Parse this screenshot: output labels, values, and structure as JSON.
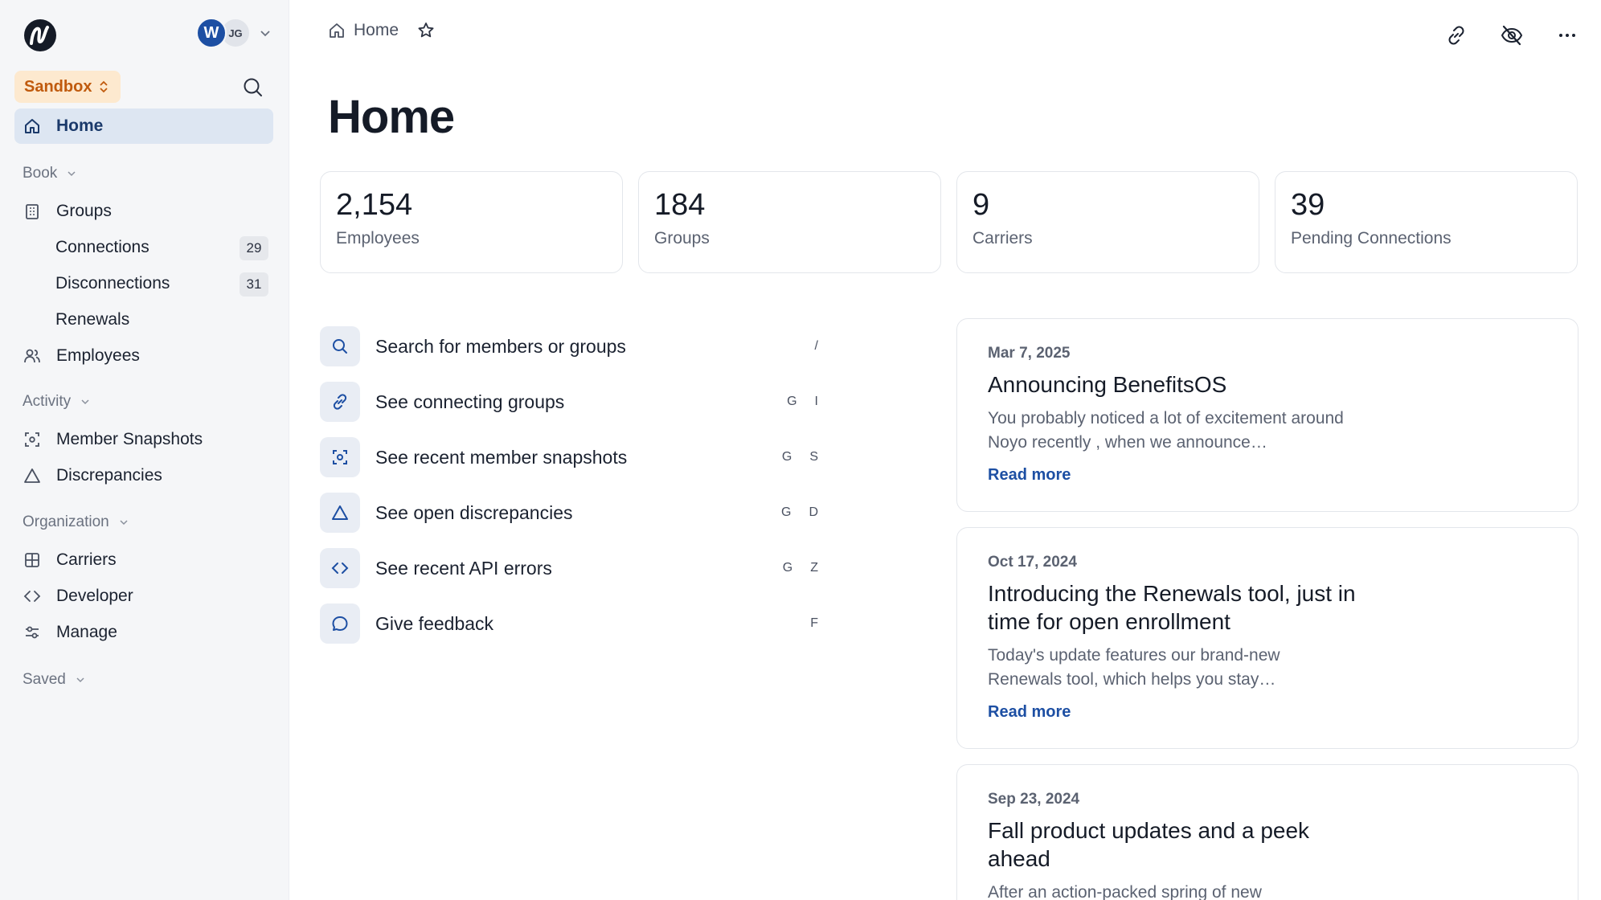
{
  "sidebar": {
    "avatar_w": "W",
    "avatar_initials": "JG",
    "sandbox_label": "Sandbox",
    "home_label": "Home",
    "sections": {
      "book": "Book",
      "activity": "Activity",
      "organization": "Organization",
      "saved": "Saved"
    },
    "items": {
      "groups": "Groups",
      "connections": "Connections",
      "connections_count": "29",
      "disconnections": "Disconnections",
      "disconnections_count": "31",
      "renewals": "Renewals",
      "employees": "Employees",
      "member_snapshots": "Member Snapshots",
      "discrepancies": "Discrepancies",
      "carriers": "Carriers",
      "developer": "Developer",
      "manage": "Manage"
    }
  },
  "header": {
    "breadcrumb": "Home",
    "title": "Home"
  },
  "stats": [
    {
      "value": "2,154",
      "label": "Employees"
    },
    {
      "value": "184",
      "label": "Groups"
    },
    {
      "value": "9",
      "label": "Carriers"
    },
    {
      "value": "39",
      "label": "Pending Connections"
    }
  ],
  "actions": [
    {
      "label": "Search for members or groups",
      "key1": "",
      "key2": "/",
      "icon": "search-icon"
    },
    {
      "label": "See connecting groups",
      "key1": "G",
      "key2": "I",
      "icon": "link-icon"
    },
    {
      "label": "See recent member snapshots",
      "key1": "G",
      "key2": "S",
      "icon": "snapshot-icon"
    },
    {
      "label": "See open discrepancies",
      "key1": "G",
      "key2": "D",
      "icon": "triangle-icon"
    },
    {
      "label": "See recent API errors",
      "key1": "G",
      "key2": "Z",
      "icon": "code-icon"
    },
    {
      "label": "Give feedback",
      "key1": "",
      "key2": "F",
      "icon": "chat-icon"
    }
  ],
  "news": [
    {
      "date": "Mar 7, 2025",
      "title": "Announcing BenefitsOS",
      "body": "You probably noticed a lot of excitement around Noyo recently , when we announce…",
      "more": "Read more"
    },
    {
      "date": "Oct 17, 2024",
      "title": "Introducing the Renewals tool, just in time for open enrollment",
      "body": "Today's update features our brand-new Renewals tool, which helps you stay…",
      "more": "Read more"
    },
    {
      "date": "Sep 23, 2024",
      "title": "Fall product updates and a peek ahead",
      "body": "After an action-packed spring of new",
      "more": ""
    }
  ],
  "colors": {
    "accent": "#1d4fa3",
    "sandbox_bg": "#fde9cf",
    "sandbox_text": "#c05a0d",
    "active_nav_bg": "#dde6f2"
  }
}
